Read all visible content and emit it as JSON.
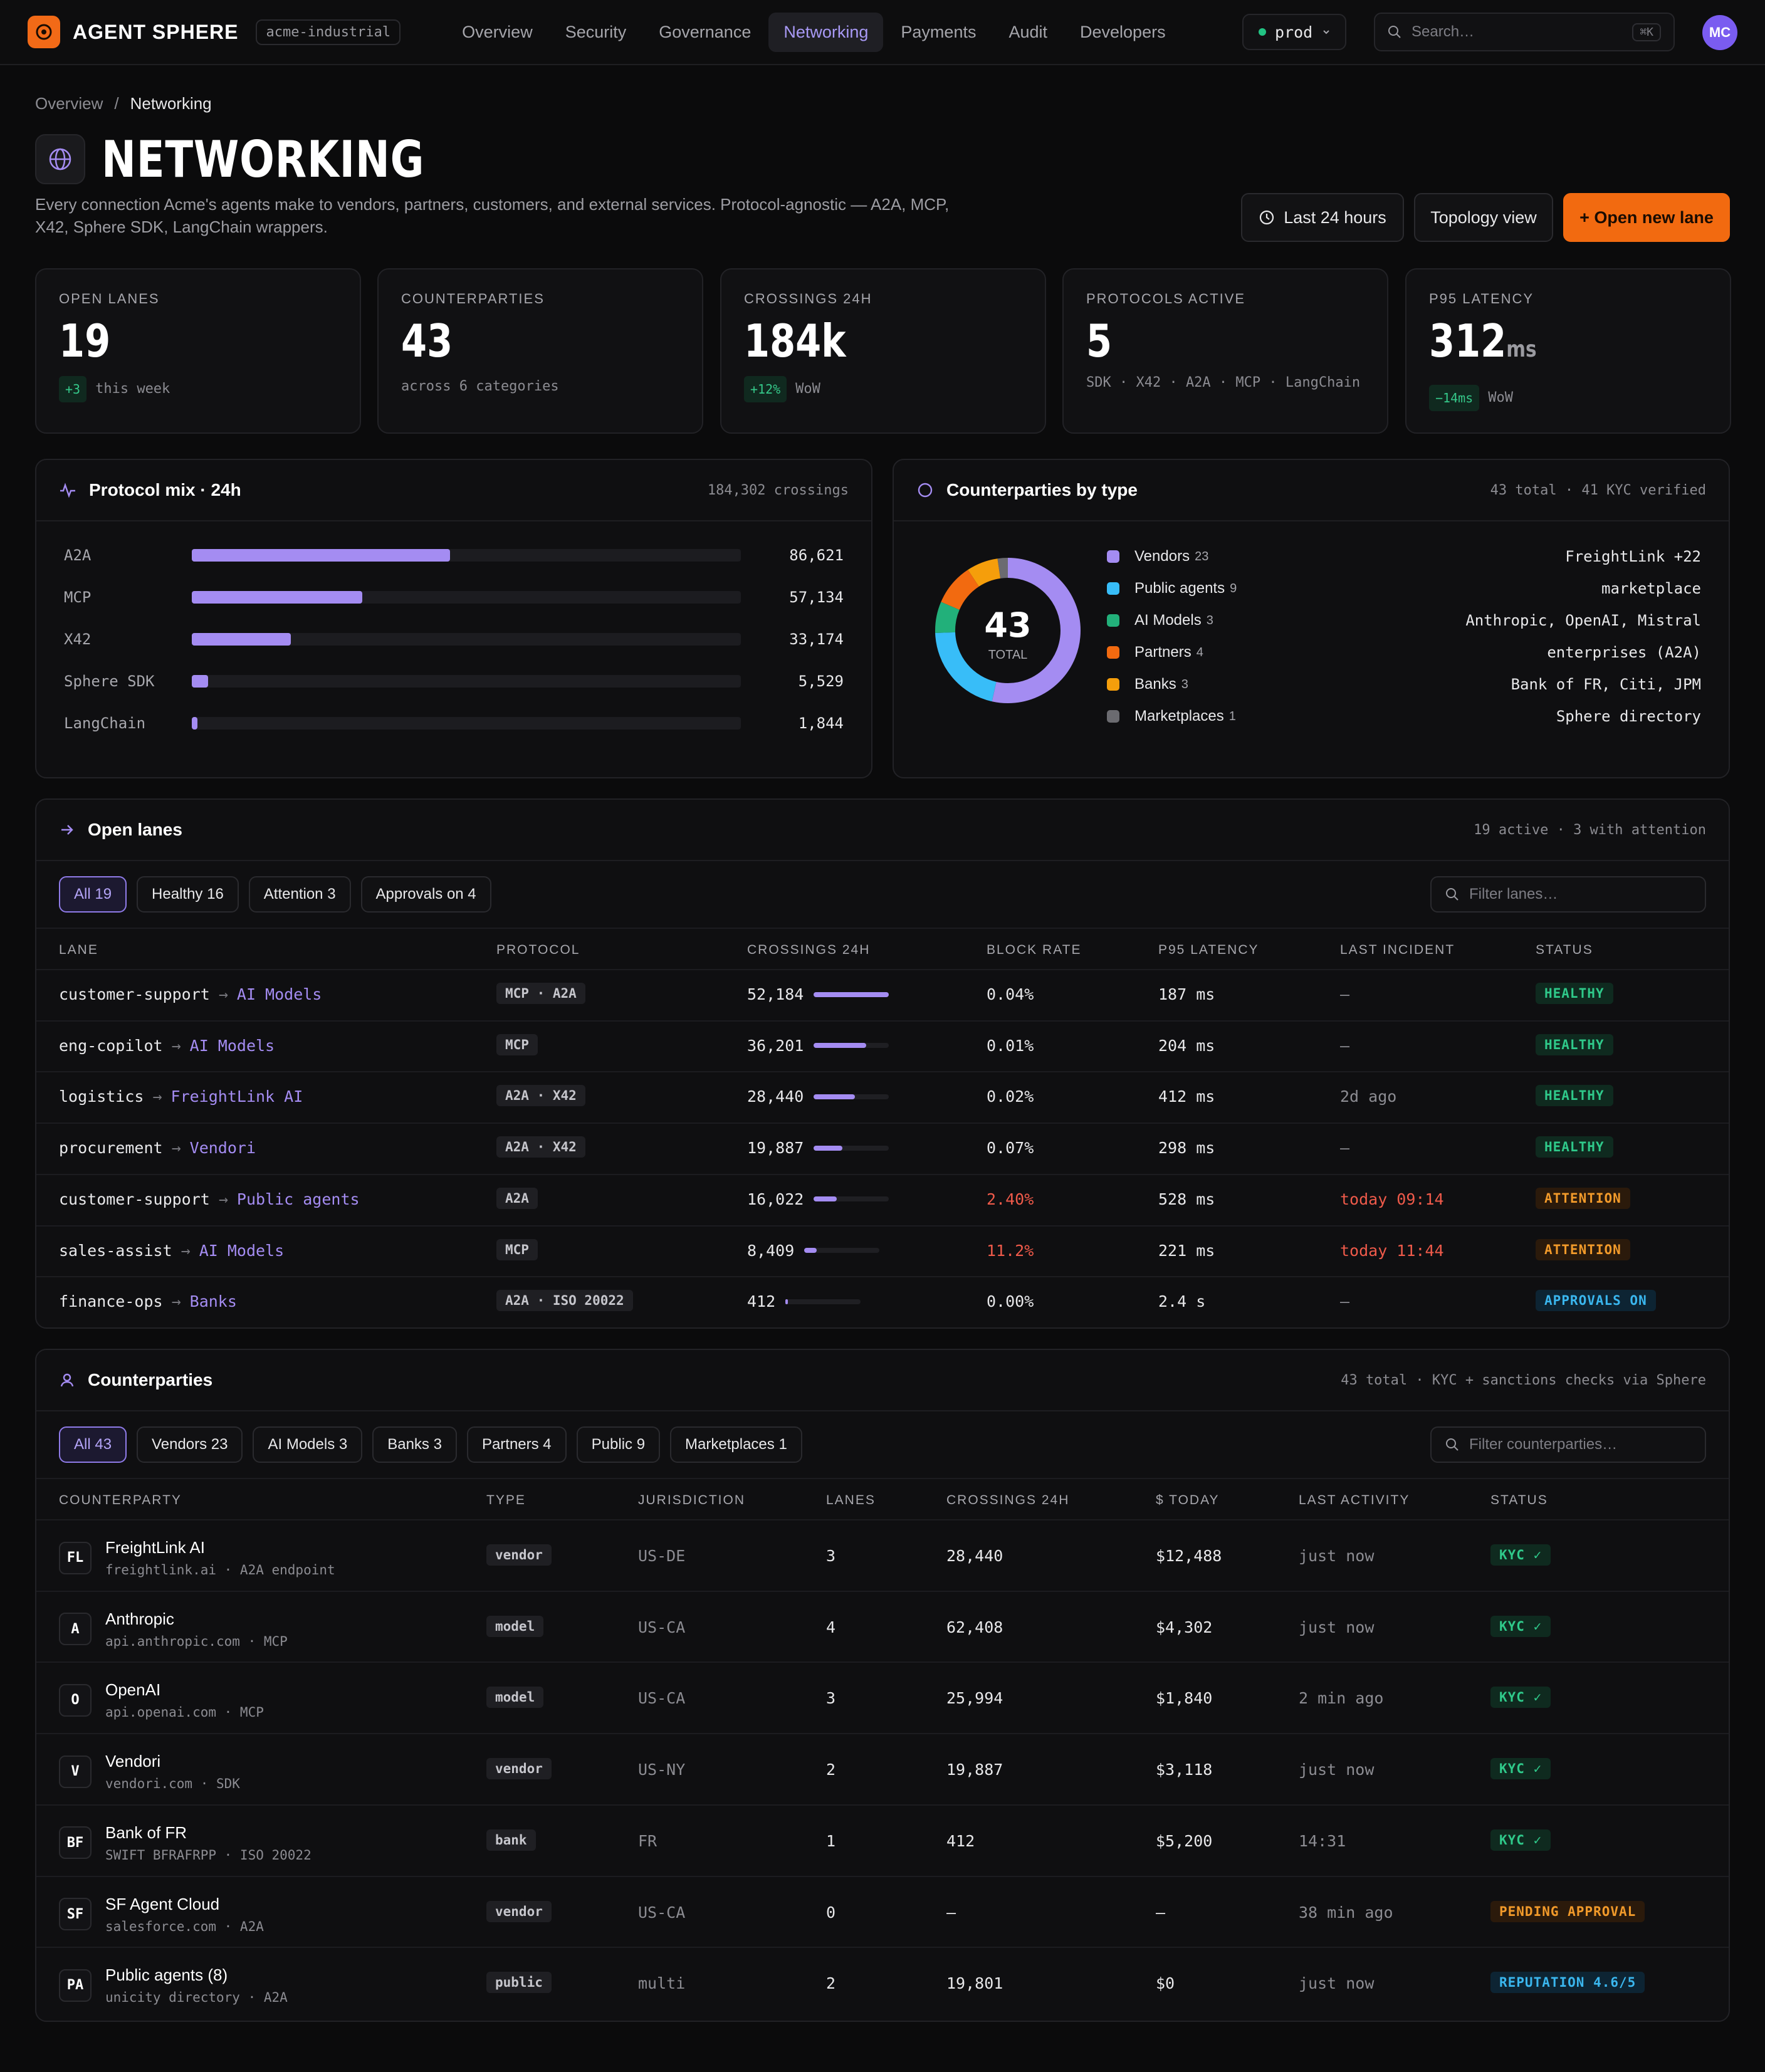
{
  "app": {
    "brand": "AGENT SPHERE",
    "org": "acme-industrial"
  },
  "nav": [
    "Overview",
    "Security",
    "Governance",
    "Networking",
    "Payments",
    "Audit",
    "Developers"
  ],
  "env": "prod",
  "search": {
    "placeholder": "Search…",
    "shortcut": "⌘K"
  },
  "user": {
    "initials": "MC"
  },
  "breadcrumb": {
    "parent": "Overview",
    "sep": "/",
    "current": "Networking"
  },
  "page": {
    "title": "NETWORKING",
    "description": "Every connection Acme's agents make to vendors, partners, customers, and external services. Protocol-agnostic — A2A, MCP, X42, Sphere SDK, LangChain wrappers."
  },
  "actions": {
    "range": "Last 24 hours",
    "topology": "Topology view",
    "open_lane": "+ Open new lane"
  },
  "kpis": [
    {
      "label": "OPEN LANES",
      "value": "19",
      "unit": "",
      "delta": "+3",
      "note": "this week"
    },
    {
      "label": "COUNTERPARTIES",
      "value": "43",
      "unit": "",
      "delta": "",
      "note": "across 6 categories"
    },
    {
      "label": "CROSSINGS 24H",
      "value": "184k",
      "unit": "",
      "delta": "+12%",
      "note": "WoW"
    },
    {
      "label": "PROTOCOLS ACTIVE",
      "value": "5",
      "unit": "",
      "delta": "",
      "note": "SDK · X42 · A2A · MCP · LangChain"
    },
    {
      "label": "P95 LATENCY",
      "value": "312",
      "unit": "ms",
      "delta": "−14ms",
      "note": "WoW"
    }
  ],
  "protocol_mix": {
    "title": "Protocol mix · 24h",
    "meta": "184,302 crossings",
    "max": 184302,
    "rows": [
      {
        "label": "A2A",
        "value": 86621,
        "display": "86,621"
      },
      {
        "label": "MCP",
        "value": 57134,
        "display": "57,134"
      },
      {
        "label": "X42",
        "value": 33174,
        "display": "33,174"
      },
      {
        "label": "Sphere SDK",
        "value": 5529,
        "display": "5,529"
      },
      {
        "label": "LangChain",
        "value": 1844,
        "display": "1,844"
      }
    ]
  },
  "counterparties_by_type": {
    "title": "Counterparties by type",
    "meta": "43 total · 41 KYC verified",
    "total": "43",
    "total_label": "TOTAL",
    "segments": [
      {
        "label": "Vendors",
        "count": 23,
        "detail": "FreightLink +22",
        "color": "#a48cf2"
      },
      {
        "label": "Public agents",
        "count": 9,
        "detail": "marketplace",
        "color": "#38bdf8"
      },
      {
        "label": "AI Models",
        "count": 3,
        "detail": "Anthropic, OpenAI, Mistral",
        "color": "#22b07a"
      },
      {
        "label": "Partners",
        "count": 4,
        "detail": "enterprises (A2A)",
        "color": "#f26a10"
      },
      {
        "label": "Banks",
        "count": 3,
        "detail": "Bank of FR, Citi, JPM",
        "color": "#f59e0b"
      },
      {
        "label": "Marketplaces",
        "count": 1,
        "detail": "Sphere directory",
        "color": "#6b6b70"
      }
    ]
  },
  "lanes": {
    "title": "Open lanes",
    "meta": "19 active · 3 with attention",
    "filters": [
      "All 19",
      "Healthy 16",
      "Attention 3",
      "Approvals on 4"
    ],
    "filter_placeholder": "Filter lanes…",
    "columns": [
      "LANE",
      "PROTOCOL",
      "CROSSINGS 24H",
      "BLOCK RATE",
      "P95 LATENCY",
      "LAST INCIDENT",
      "STATUS"
    ],
    "max_crossings": 52184,
    "rows": [
      {
        "from": "customer-support",
        "to": "AI Models",
        "protocol": "MCP · A2A",
        "crossings": "52,184",
        "crossings_n": 52184,
        "block": "0.04%",
        "block_alert": false,
        "latency": "187 ms",
        "incident": "—",
        "incident_alert": false,
        "status": "HEALTHY",
        "status_kind": "healthy"
      },
      {
        "from": "eng-copilot",
        "to": "AI Models",
        "protocol": "MCP",
        "crossings": "36,201",
        "crossings_n": 36201,
        "block": "0.01%",
        "block_alert": false,
        "latency": "204 ms",
        "incident": "—",
        "incident_alert": false,
        "status": "HEALTHY",
        "status_kind": "healthy"
      },
      {
        "from": "logistics",
        "to": "FreightLink AI",
        "protocol": "A2A · X42",
        "crossings": "28,440",
        "crossings_n": 28440,
        "block": "0.02%",
        "block_alert": false,
        "latency": "412 ms",
        "incident": "2d ago",
        "incident_alert": false,
        "status": "HEALTHY",
        "status_kind": "healthy"
      },
      {
        "from": "procurement",
        "to": "Vendori",
        "protocol": "A2A · X42",
        "crossings": "19,887",
        "crossings_n": 19887,
        "block": "0.07%",
        "block_alert": false,
        "latency": "298 ms",
        "incident": "—",
        "incident_alert": false,
        "status": "HEALTHY",
        "status_kind": "healthy"
      },
      {
        "from": "customer-support",
        "to": "Public agents",
        "protocol": "A2A",
        "crossings": "16,022",
        "crossings_n": 16022,
        "block": "2.40%",
        "block_alert": true,
        "latency": "528 ms",
        "incident": "today 09:14",
        "incident_alert": true,
        "status": "ATTENTION",
        "status_kind": "attention"
      },
      {
        "from": "sales-assist",
        "to": "AI Models",
        "protocol": "MCP",
        "crossings": "8,409",
        "crossings_n": 8409,
        "block": "11.2%",
        "block_alert": true,
        "latency": "221 ms",
        "incident": "today 11:44",
        "incident_alert": true,
        "status": "ATTENTION",
        "status_kind": "attention"
      },
      {
        "from": "finance-ops",
        "to": "Banks",
        "protocol": "A2A · ISO 20022",
        "crossings": "412",
        "crossings_n": 412,
        "block": "0.00%",
        "block_alert": false,
        "latency": "2.4 s",
        "incident": "—",
        "incident_alert": false,
        "status": "APPROVALS ON",
        "status_kind": "approvals"
      }
    ]
  },
  "counterparties": {
    "title": "Counterparties",
    "meta": "43 total · KYC + sanctions checks via Sphere",
    "filters": [
      "All 43",
      "Vendors 23",
      "AI Models 3",
      "Banks 3",
      "Partners 4",
      "Public 9",
      "Marketplaces 1"
    ],
    "filter_placeholder": "Filter counterparties…",
    "columns": [
      "COUNTERPARTY",
      "TYPE",
      "JURISDICTION",
      "LANES",
      "CROSSINGS 24H",
      "$ TODAY",
      "LAST ACTIVITY",
      "STATUS"
    ],
    "rows": [
      {
        "initials": "FL",
        "name": "FreightLink AI",
        "sub": "freightlink.ai · A2A endpoint",
        "type": "vendor",
        "jurisdiction": "US-DE",
        "lanes": "3",
        "crossings": "28,440",
        "today": "$12,488",
        "activity": "just now",
        "status": "KYC ✓",
        "status_kind": "kyc"
      },
      {
        "initials": "A",
        "name": "Anthropic",
        "sub": "api.anthropic.com · MCP",
        "type": "model",
        "jurisdiction": "US-CA",
        "lanes": "4",
        "crossings": "62,408",
        "today": "$4,302",
        "activity": "just now",
        "status": "KYC ✓",
        "status_kind": "kyc"
      },
      {
        "initials": "O",
        "name": "OpenAI",
        "sub": "api.openai.com · MCP",
        "type": "model",
        "jurisdiction": "US-CA",
        "lanes": "3",
        "crossings": "25,994",
        "today": "$1,840",
        "activity": "2 min ago",
        "status": "KYC ✓",
        "status_kind": "kyc"
      },
      {
        "initials": "V",
        "name": "Vendori",
        "sub": "vendori.com · SDK",
        "type": "vendor",
        "jurisdiction": "US-NY",
        "lanes": "2",
        "crossings": "19,887",
        "today": "$3,118",
        "activity": "just now",
        "status": "KYC ✓",
        "status_kind": "kyc"
      },
      {
        "initials": "BF",
        "name": "Bank of FR",
        "sub": "SWIFT BFRAFRPP · ISO 20022",
        "type": "bank",
        "jurisdiction": "FR",
        "lanes": "1",
        "crossings": "412",
        "today": "$5,200",
        "activity": "14:31",
        "status": "KYC ✓",
        "status_kind": "kyc"
      },
      {
        "initials": "SF",
        "name": "SF Agent Cloud",
        "sub": "salesforce.com · A2A",
        "type": "vendor",
        "jurisdiction": "US-CA",
        "lanes": "0",
        "crossings": "—",
        "today": "—",
        "activity": "38 min ago",
        "status": "PENDING APPROVAL",
        "status_kind": "pending"
      },
      {
        "initials": "PA",
        "name": "Public agents (8)",
        "sub": "unicity directory · A2A",
        "type": "public",
        "jurisdiction": "multi",
        "lanes": "2",
        "crossings": "19,801",
        "today": "$0",
        "activity": "just now",
        "status": "REPUTATION 4.6/5",
        "status_kind": "rep"
      }
    ]
  }
}
